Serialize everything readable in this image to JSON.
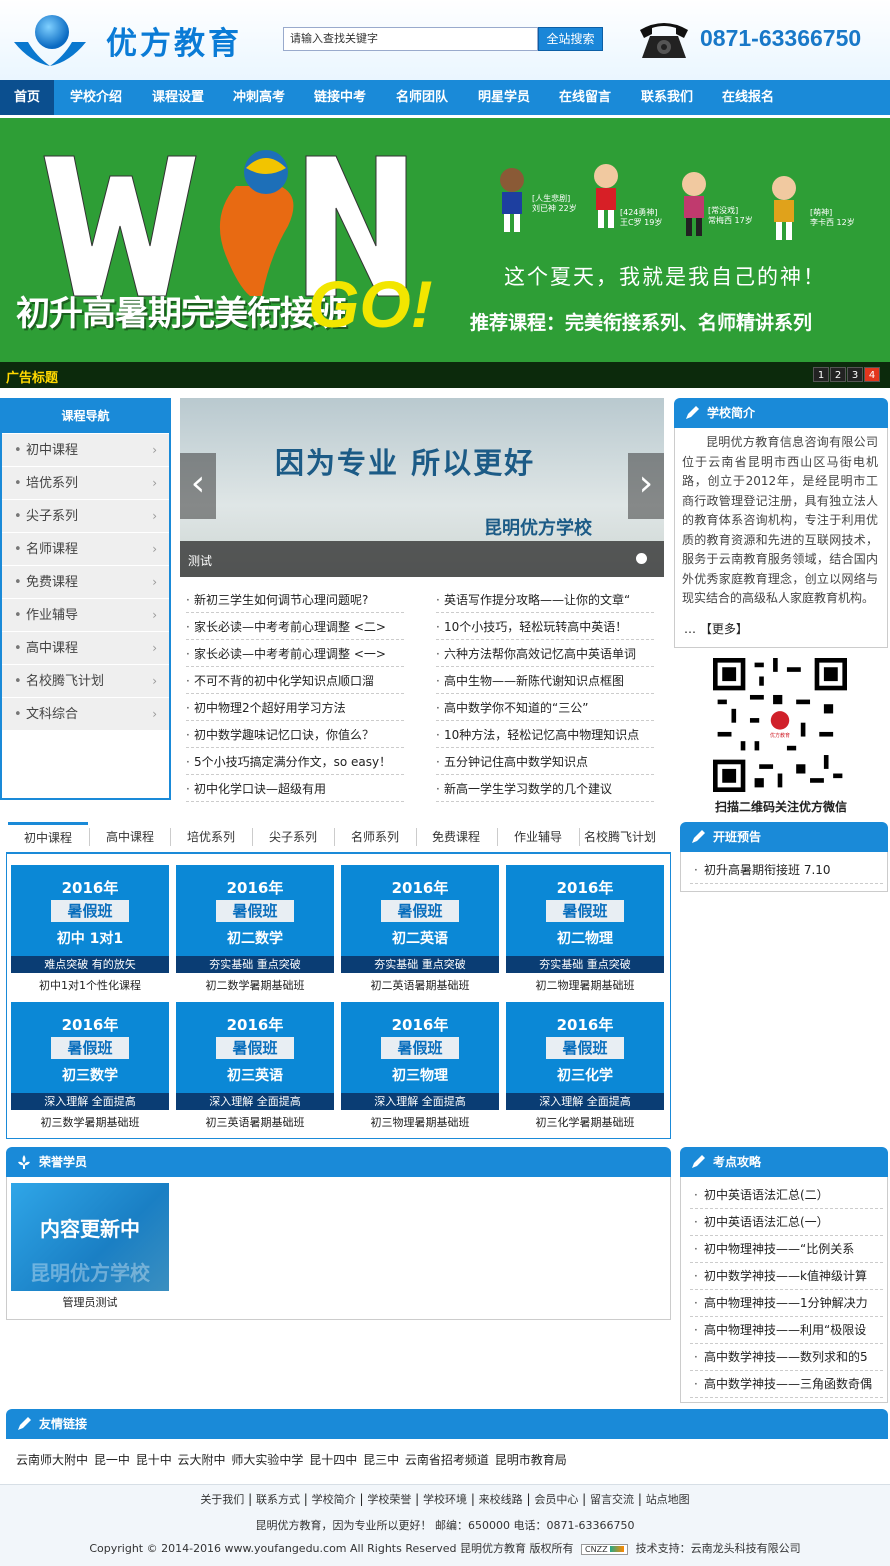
{
  "header": {
    "logo_text": "优方教育",
    "search_placeholder": "请输入查找关键字",
    "search_button": "全站搜索",
    "phone": "0871-63366750"
  },
  "nav": {
    "items": [
      "首页",
      "学校介绍",
      "课程设置",
      "冲刺高考",
      "链接中考",
      "名师团队",
      "明星学员",
      "在线留言",
      "联系我们",
      "在线报名"
    ],
    "active": "首页"
  },
  "banner": {
    "caption_title": "广告标题",
    "slogan": "这个夏天，我就是我自己的神！",
    "headline": "初升高暑期完美衔接班",
    "go": "GO!",
    "recommend": "推荐课程：完美衔接系列、名师精讲系列",
    "characters": [
      {
        "note": "[人生悲剧]",
        "name": "刘已神",
        "age": "22岁"
      },
      {
        "note": "[424勇神]",
        "name": "王C罗",
        "age": "19岁"
      },
      {
        "note": "[常没戏]",
        "name": "常梅西",
        "age": "17岁"
      },
      {
        "note": "[萌神]",
        "name": "李卡西",
        "age": "12岁"
      }
    ],
    "pages": [
      "1",
      "2",
      "3",
      "4"
    ],
    "active_page": "4"
  },
  "course_nav": {
    "title": "课程导航",
    "items": [
      "初中课程",
      "培优系列",
      "尖子系列",
      "名师课程",
      "免费课程",
      "作业辅导",
      "高中课程",
      "名校腾飞计划",
      "文科综合"
    ]
  },
  "slider": {
    "headline": "因为专业 所以更好",
    "school": "昆明优方学校",
    "caption": "测试"
  },
  "news": {
    "left": [
      "新初三学生如何调节心理问题呢?",
      "家长必读—中考考前心理调整 <二>",
      "家长必读—中考考前心理调整 <一>",
      "不可不背的初中化学知识点顺口溜",
      "初中物理2个超好用学习方法",
      "初中数学趣味记忆口诀，你值么？",
      "5个小技巧搞定满分作文，so easy！",
      "初中化学口诀—超级有用"
    ],
    "right": [
      "英语写作提分攻略——让你的文章“",
      "10个小技巧，轻松玩转高中英语！",
      "六种方法帮你高效记忆高中英语单词",
      "高中生物——新陈代谢知识点框图",
      "高中数学你不知道的“三公”",
      "10种方法，轻松记忆高中物理知识点",
      "五分钟记住高中数学知识点",
      "新高一学生学习数学的几个建议"
    ]
  },
  "school_intro": {
    "title": "学校简介",
    "text": "昆明优方教育信息咨询有限公司位于云南省昆明市西山区马街电机路，创立于2012年，是经昆明市工商行政管理登记注册，具有独立法人的教育体系咨询机构，专注于利用优质的教育资源和先进的互联网技术，服务于云南教育服务领域，结合国内外优秀家庭教育理念，创立以网络与现实结合的高级私人家庭教育机构。",
    "more": "【更多】",
    "more_prefix": "…",
    "qr_badge": "优方教育",
    "qr_caption": "扫描二维码关注优方微信"
  },
  "tabs": {
    "items": [
      "初中课程",
      "高中课程",
      "培优系列",
      "尖子系列",
      "名师系列",
      "免费课程",
      "作业辅导",
      "名校腾飞计划"
    ],
    "active": "初中课程"
  },
  "cards": [
    {
      "year": "2016年",
      "tag": "暑假班",
      "subject": "初中 1对1",
      "strip": "难点突破  有的放矢",
      "caption": "初中1对1个性化课程"
    },
    {
      "year": "2016年",
      "tag": "暑假班",
      "subject": "初二数学",
      "strip": "夯实基础  重点突破",
      "caption": "初二数学暑期基础班"
    },
    {
      "year": "2016年",
      "tag": "暑假班",
      "subject": "初二英语",
      "strip": "夯实基础  重点突破",
      "caption": "初二英语暑期基础班"
    },
    {
      "year": "2016年",
      "tag": "暑假班",
      "subject": "初二物理",
      "strip": "夯实基础  重点突破",
      "caption": "初二物理暑期基础班"
    },
    {
      "year": "2016年",
      "tag": "暑假班",
      "subject": "初三数学",
      "strip": "深入理解  全面提高",
      "caption": "初三数学暑期基础班"
    },
    {
      "year": "2016年",
      "tag": "暑假班",
      "subject": "初三英语",
      "strip": "深入理解  全面提高",
      "caption": "初三英语暑期基础班"
    },
    {
      "year": "2016年",
      "tag": "暑假班",
      "subject": "初三物理",
      "strip": "深入理解  全面提高",
      "caption": "初三物理暑期基础班"
    },
    {
      "year": "2016年",
      "tag": "暑假班",
      "subject": "初三化学",
      "strip": "深入理解  全面提高",
      "caption": "初三化学暑期基础班"
    }
  ],
  "opening": {
    "title": "开班预告",
    "items": [
      "初升高暑期衔接班 7.10"
    ]
  },
  "honor": {
    "title": "荣誉学员",
    "thumb_text": "内容更新中",
    "thumb_sub": "昆明优方学校",
    "caption": "管理员测试"
  },
  "tips": {
    "title": "考点攻略",
    "items": [
      "初中英语语法汇总(二）",
      "初中英语语法汇总(一）",
      "初中物理神技——“比例关系",
      "初中数学神技——k值神级计算",
      "高中物理神技——1分钟解决力",
      "高中物理神技——利用“极限设",
      "高中数学神技——数列求和的5",
      "高中数学神技——三角函数奇偶"
    ]
  },
  "links": {
    "title": "友情链接",
    "items": [
      "云南师大附中",
      "昆一中",
      "昆十中",
      "云大附中",
      "师大实验中学",
      "昆十四中",
      "昆三中",
      "云南省招考频道",
      "昆明市教育局"
    ]
  },
  "footer": {
    "links": [
      "关于我们",
      "联系方式",
      "学校简介",
      "学校荣誉",
      "学校环境",
      "来校线路",
      "会员中心",
      "留言交流",
      "站点地图"
    ],
    "info": "昆明优方教育，因为专业所以更好！ 邮编：650000 电话：0871-63366750",
    "copyright": "Copyright © 2014-2016 www.youfangedu.com All Rights Reserved 昆明优方教育 版权所有",
    "cnzz": "CNZZ",
    "support": "技术支持：云南龙头科技有限公司"
  },
  "colors": {
    "brand_blue": "#1a8ad8",
    "nav_active": "#0b4f8f",
    "banner_green": "#2e9e36",
    "go_yellow": "#f2e600",
    "active_dot": "#e2361e"
  }
}
